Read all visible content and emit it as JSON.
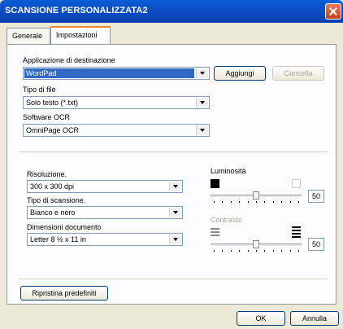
{
  "window": {
    "title": "SCANSIONE PERSONALIZZATA2"
  },
  "tabs": [
    {
      "label": "Generale"
    },
    {
      "label": "Impostazioni"
    }
  ],
  "destination": {
    "label": "Applicazione di destinazione",
    "value": "WordPad",
    "add_label": "Aggiungi",
    "delete_label": "Cancella"
  },
  "file_type": {
    "label": "Tipo di file",
    "value": "Solo testo (*.txt)"
  },
  "ocr": {
    "label": "Software OCR",
    "value": "OmniPage OCR"
  },
  "resolution": {
    "label": "Risoluzione.",
    "value": "300 x 300 dpi"
  },
  "scan_type": {
    "label": "Tipo di scansione.",
    "value": "Bianco e nero"
  },
  "doc_size": {
    "label": "Dimensioni documento",
    "value": "Letter 8 ½ x 11 in"
  },
  "brightness": {
    "label": "Luminosità",
    "value": "50",
    "level": 0.5
  },
  "contrast": {
    "label": "Contrasto",
    "value": "50",
    "level": 0.5
  },
  "restore_label": "Ripristina predefiniti",
  "footer": {
    "ok_label": "OK",
    "cancel_label": "Annulla"
  }
}
